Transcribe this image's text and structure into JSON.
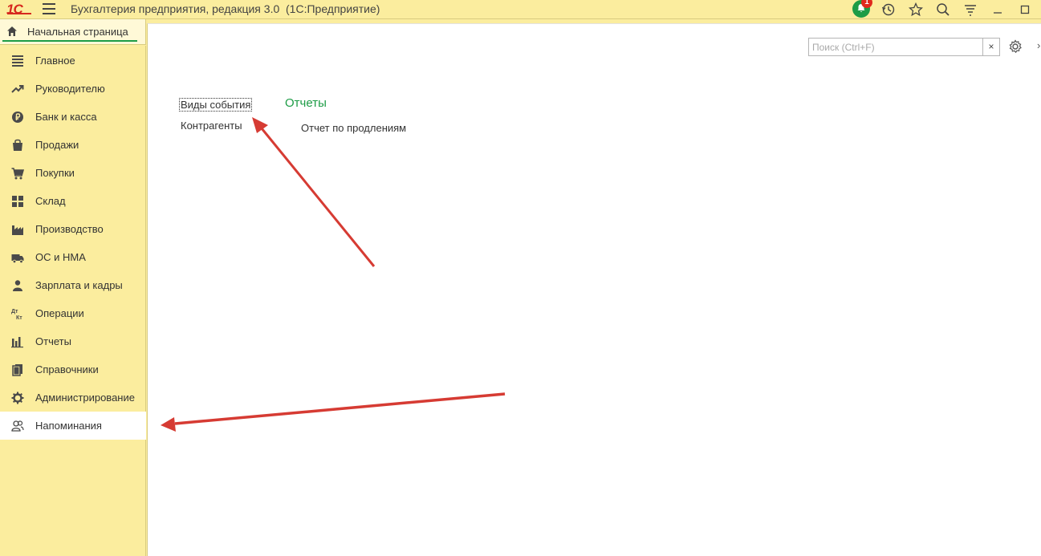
{
  "window": {
    "logo": "1С",
    "title": "Бухгалтерия предприятия, редакция 3.0  (1С:Предприятие)",
    "notifications_count": "1"
  },
  "home_tab": {
    "label": "Начальная страница"
  },
  "sidebar": {
    "items": [
      {
        "label": "Главное",
        "icon": "menu-lines-icon"
      },
      {
        "label": "Руководителю",
        "icon": "trend-icon"
      },
      {
        "label": "Банк и касса",
        "icon": "ruble-coin-icon"
      },
      {
        "label": "Продажи",
        "icon": "shopping-bag-icon"
      },
      {
        "label": "Покупки",
        "icon": "cart-icon"
      },
      {
        "label": "Склад",
        "icon": "warehouse-grid-icon"
      },
      {
        "label": "Производство",
        "icon": "factory-icon"
      },
      {
        "label": "ОС и НМА",
        "icon": "truck-icon"
      },
      {
        "label": "Зарплата и кадры",
        "icon": "person-icon"
      },
      {
        "label": "Операции",
        "icon": "dt-kt-icon"
      },
      {
        "label": "Отчеты",
        "icon": "bar-chart-icon"
      },
      {
        "label": "Справочники",
        "icon": "books-icon"
      },
      {
        "label": "Администрирование",
        "icon": "gear-icon"
      },
      {
        "label": "Напоминания",
        "icon": "people-icon",
        "active": true
      }
    ]
  },
  "search": {
    "placeholder": "Поиск (Ctrl+F)",
    "clear": "×"
  },
  "main": {
    "links": [
      "Виды события",
      "Контрагенты"
    ],
    "reports_section": {
      "title": "Отчеты",
      "items": [
        "Отчет по продлениям"
      ]
    }
  },
  "colors": {
    "panel": "#fbed9e",
    "accent_green": "#1d9c46",
    "annotation_red": "#d63b33"
  }
}
